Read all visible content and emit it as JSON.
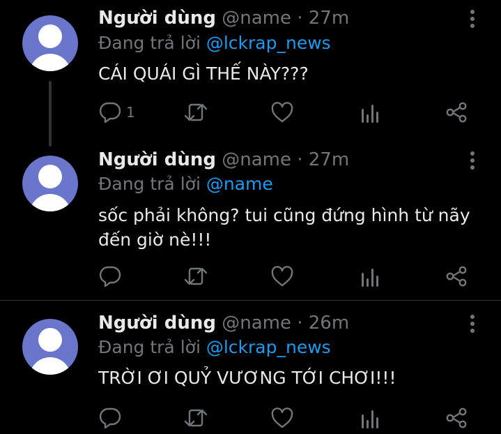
{
  "tweets": [
    {
      "display_name": "Người dùng",
      "handle": "@name",
      "separator": "·",
      "time": "27m",
      "reply_prefix": "Đang trả lời",
      "reply_to": "@lckrap_news",
      "text": "CÁI QUÁI GÌ THẾ NÀY???",
      "reply_count": "1"
    },
    {
      "display_name": "Người dùng",
      "handle": "@name",
      "separator": "·",
      "time": "27m",
      "reply_prefix": "Đang trả lời",
      "reply_to": "@name",
      "text": "sốc phải không? tui cũng đứng hình từ nãy đến giờ nè!!!",
      "reply_count": ""
    },
    {
      "display_name": "Người dùng",
      "handle": "@name",
      "separator": "·",
      "time": "26m",
      "reply_prefix": "Đang trả lời",
      "reply_to": "@lckrap_news",
      "text": "TRỜI ƠI QUỶ VƯƠNG TỚI CHƠI!!!",
      "reply_count": ""
    }
  ],
  "icons": {
    "reply": "reply-bubble-icon",
    "retweet": "retweet-icon",
    "like": "heart-icon",
    "analytics": "analytics-bars-icon",
    "share": "share-icon",
    "more": "more-vertical-icon",
    "avatar": "default-avatar-icon"
  },
  "colors": {
    "background": "#000000",
    "primary_text": "#e7e9ea",
    "secondary_text": "#71767b",
    "mention": "#1d9bf0",
    "avatar": "#6a76cc",
    "border": "#2f3336"
  }
}
